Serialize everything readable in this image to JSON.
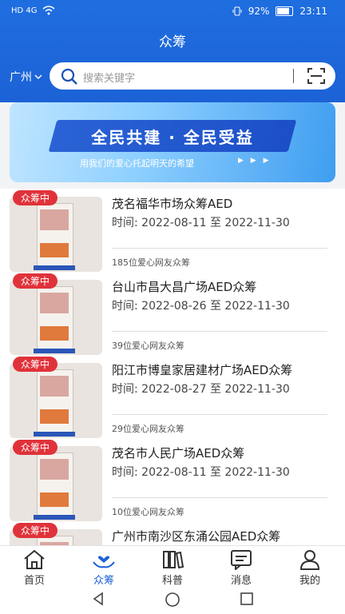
{
  "status": {
    "left_icons": "HD 4G",
    "battery": "92%",
    "time": "23:11"
  },
  "header": {
    "title": "众筹",
    "city": "广州"
  },
  "search": {
    "placeholder": "搜索关键字"
  },
  "banner": {
    "slogan": "全民共建 · 全民受益",
    "sub": "用我们的爱心托起明天的希望",
    "arrows": "▶ ▶ ▶"
  },
  "items": [
    {
      "badge": "众筹中",
      "name": "茂名福华市场众筹AED",
      "time": "时间: 2022-08-11 至 2022-11-30",
      "fans": "185位爱心网友众筹"
    },
    {
      "badge": "众筹中",
      "name": "台山市昌大昌广场AED众筹",
      "time": "时间: 2022-08-26 至 2022-11-30",
      "fans": "39位爱心网友众筹"
    },
    {
      "badge": "众筹中",
      "name": "阳江市博皇家居建材广场AED众筹",
      "time": "时间: 2022-08-27 至 2022-11-30",
      "fans": "29位爱心网友众筹"
    },
    {
      "badge": "众筹中",
      "name": "茂名市人民广场AED众筹",
      "time": "时间: 2022-08-11 至 2022-11-30",
      "fans": "10位爱心网友众筹"
    },
    {
      "badge": "众筹中",
      "name": "广州市南沙区东涌公园AED众筹",
      "time": "",
      "fans": ""
    }
  ],
  "tabs": [
    {
      "label": "首页",
      "icon": "home-icon"
    },
    {
      "label": "众筹",
      "icon": "hands-heart-icon"
    },
    {
      "label": "科普",
      "icon": "books-icon"
    },
    {
      "label": "消息",
      "icon": "message-icon"
    },
    {
      "label": "我的",
      "icon": "person-icon"
    }
  ],
  "colors": {
    "primary": "#1c62d6",
    "badge": "#e0323a"
  }
}
